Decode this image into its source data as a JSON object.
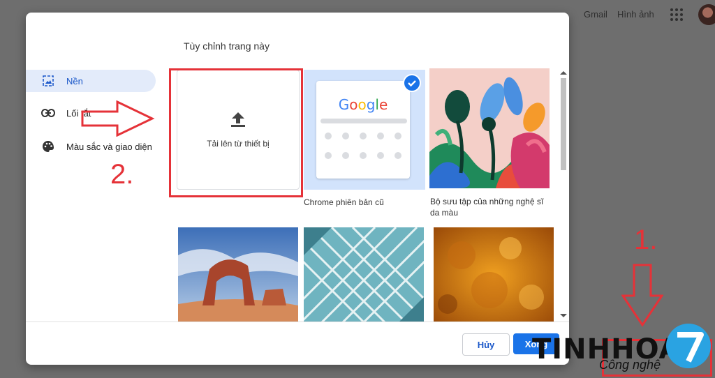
{
  "header": {
    "gmail": "Gmail",
    "images": "Hình ảnh"
  },
  "dialog": {
    "title": "Tùy chỉnh trang này"
  },
  "sidebar": {
    "items": [
      {
        "label": "Nền",
        "icon": "wallpaper-icon"
      },
      {
        "label": "Lối tắt",
        "icon": "link-icon"
      },
      {
        "label": "Màu sắc và giao diện",
        "icon": "palette-icon"
      }
    ]
  },
  "grid": {
    "upload_label": "Tải lên từ thiết bị",
    "chrome_caption": "Chrome phiên bản cũ",
    "artist_caption_1": "Bộ sưu tập của những nghệ sĩ",
    "artist_caption_2": "da màu",
    "google_text": "Google"
  },
  "buttons": {
    "cancel": "Hủy",
    "done": "Xong"
  },
  "annotations": {
    "step1": "1.",
    "step2": "2."
  },
  "watermark": {
    "brand": "TINHHOA",
    "sub": "Công nghệ"
  },
  "colors": {
    "accent": "#1a73e8",
    "annotation": "#e53238",
    "nav_active": "#e3ebfa"
  }
}
